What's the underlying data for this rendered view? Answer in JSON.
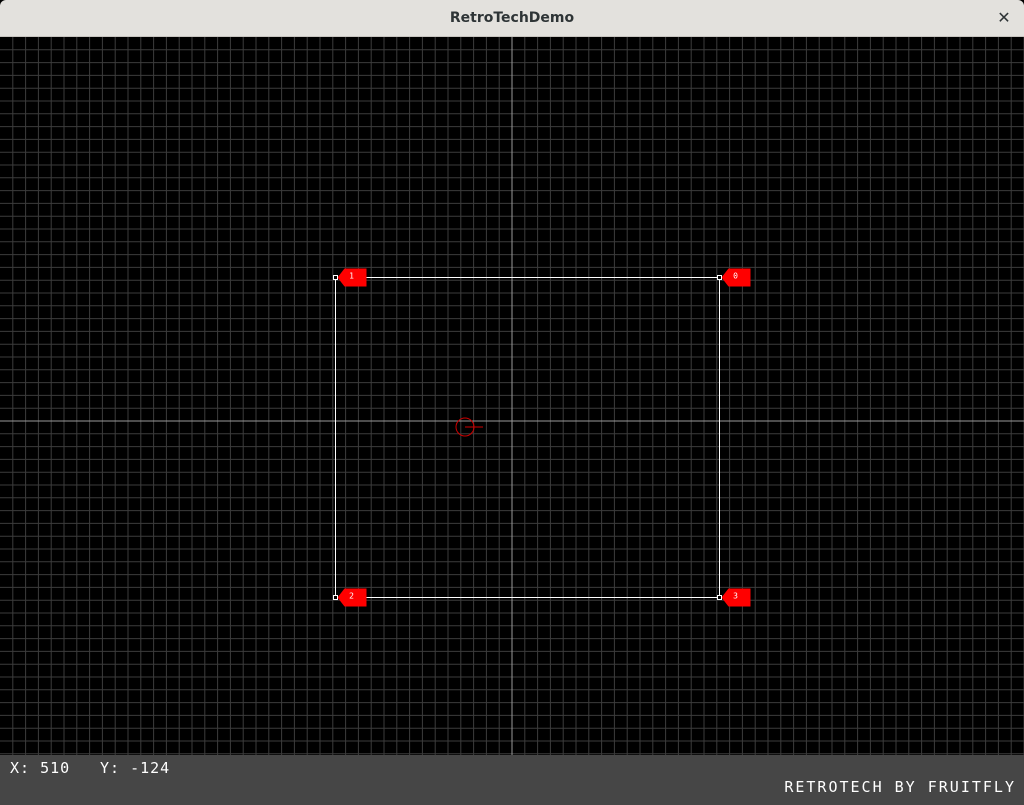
{
  "window": {
    "title": "RetroTechDemo",
    "close_glyph": "✕"
  },
  "editor": {
    "vertices": [
      {
        "label": "1"
      },
      {
        "label": "0"
      },
      {
        "label": "2"
      },
      {
        "label": "3"
      }
    ],
    "colors": {
      "background": "#000000",
      "grid": "#3c3c3c",
      "axis": "#9a9a9a",
      "outline": "#ffffff",
      "marker": "#ff0000",
      "cursor": "#cc0000"
    },
    "cursor_icon": "crosshair-circle-icon"
  },
  "status": {
    "x_label": "X:",
    "x_value": "510",
    "y_label": "Y:",
    "y_value": "-124",
    "credit": "RETROTECH BY FRUITFLY"
  }
}
